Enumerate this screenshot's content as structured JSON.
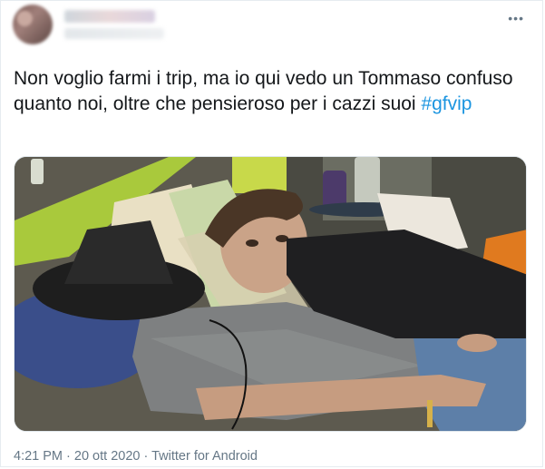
{
  "tweet": {
    "text": "Non voglio farmi i trip, ma io qui vedo un Tommaso confuso quanto noi, oltre che pensieroso per i cazzi suoi",
    "hashtag": "#gfvip",
    "more_icon": "more-dots-icon"
  },
  "author": {
    "avatar": "blurred-avatar",
    "name_redacted": true,
    "handle_redacted": true
  },
  "meta": {
    "time": "4:21 PM",
    "separator": " · ",
    "date": "20 ott 2020",
    "source": "Twitter for Android"
  },
  "media": {
    "alt": "photo"
  },
  "colors": {
    "text": "#14171a",
    "hashtag": "#1b95e0",
    "meta": "#657786",
    "border": "#e6ecf0"
  }
}
